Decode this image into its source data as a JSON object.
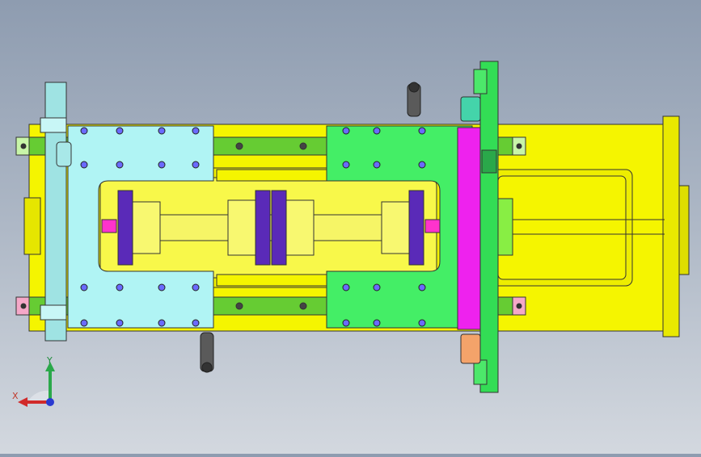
{
  "viewport": {
    "background_top": "#8e9cb0",
    "background_bottom": "#d3d8df"
  },
  "model": {
    "parts": [
      {
        "name": "base-frame",
        "color": "#f5f500"
      },
      {
        "name": "left-end-plate",
        "color": "#a8e8e8"
      },
      {
        "name": "left-clamp-block",
        "color": "#b0f4f4"
      },
      {
        "name": "right-clamp-block",
        "color": "#44ee66"
      },
      {
        "name": "guide-rails",
        "color": "#66cc33"
      },
      {
        "name": "cylinder-rod",
        "color": "#f6f566"
      },
      {
        "name": "clamp-collars",
        "color": "#5a2ab8"
      },
      {
        "name": "pink-slide-plate",
        "color": "#ee22ee"
      },
      {
        "name": "green-end-plate",
        "color": "#33dd55"
      },
      {
        "name": "handle-levers",
        "color": "#5a5a5a"
      },
      {
        "name": "nuts",
        "color": "#ff33cc"
      }
    ]
  },
  "triad": {
    "x_label": "X",
    "y_label": "Y",
    "x_color": "#d12a2a",
    "y_color": "#2aa84a",
    "z_color": "#2a3ad1"
  }
}
